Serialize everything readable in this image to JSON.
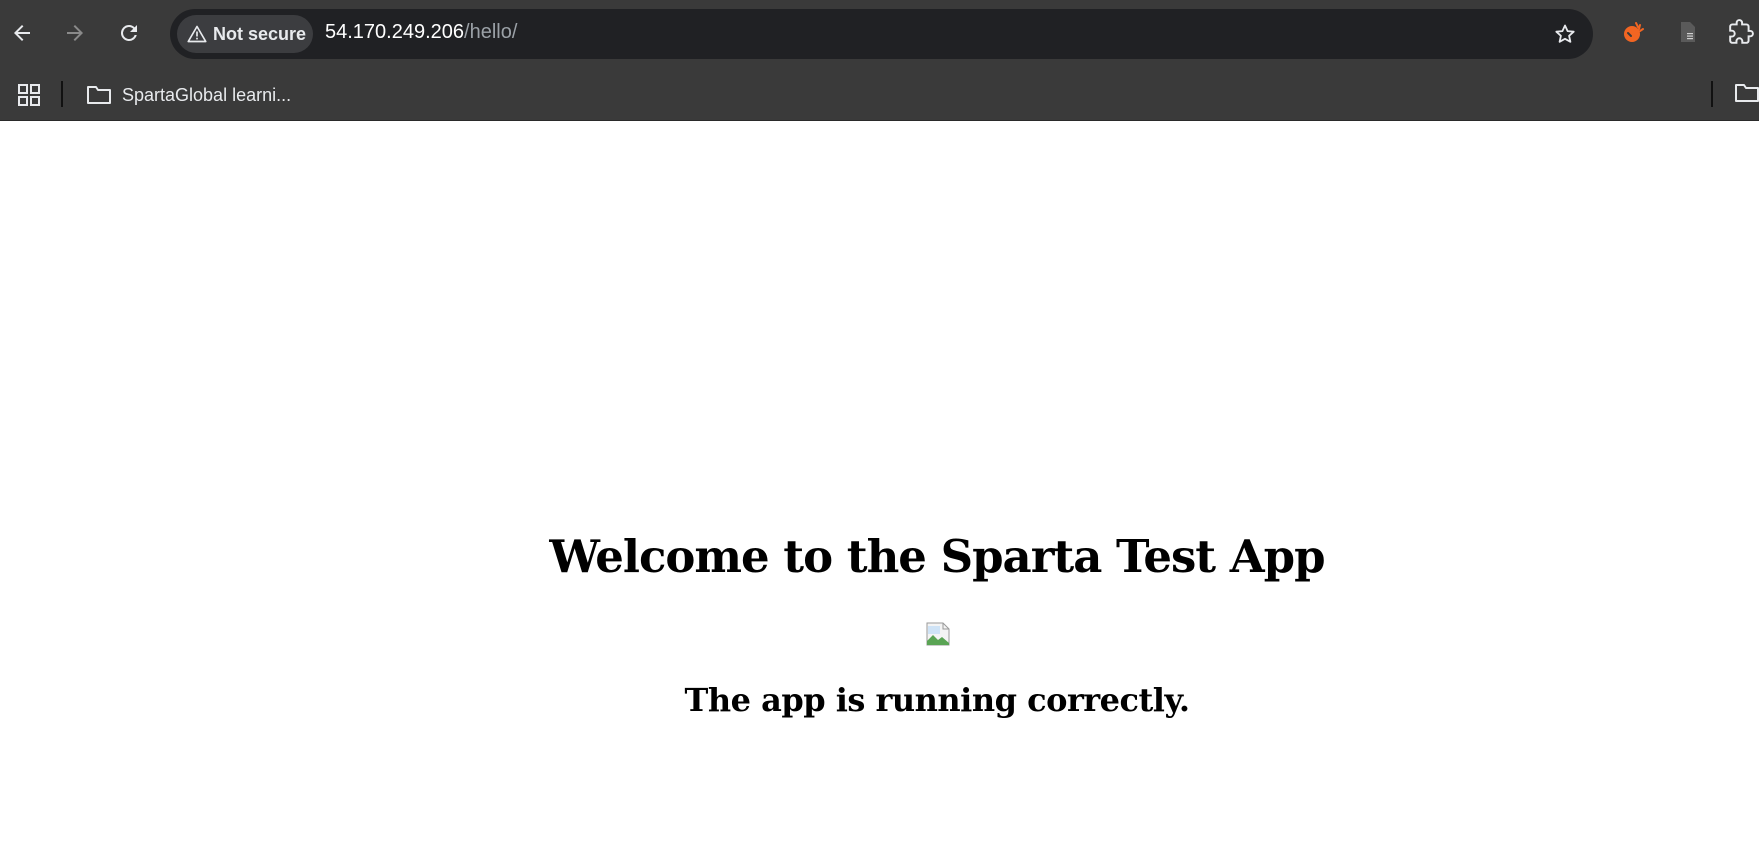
{
  "browser": {
    "security_label": "Not secure",
    "url_host": "54.170.249.206",
    "url_path": "/hello/",
    "icons": {
      "back": "arrow-left-icon",
      "forward": "arrow-right-icon",
      "reload": "reload-icon",
      "warning": "warning-triangle-icon",
      "bookmark": "star-icon",
      "extensions": "puzzle-icon"
    },
    "accent_extension_color": "#f26522"
  },
  "bookmarks": {
    "folder_label": "SpartaGlobal learni..."
  },
  "page": {
    "title": "Welcome to the Sparta Test App",
    "subtitle": "The app is running correctly."
  }
}
